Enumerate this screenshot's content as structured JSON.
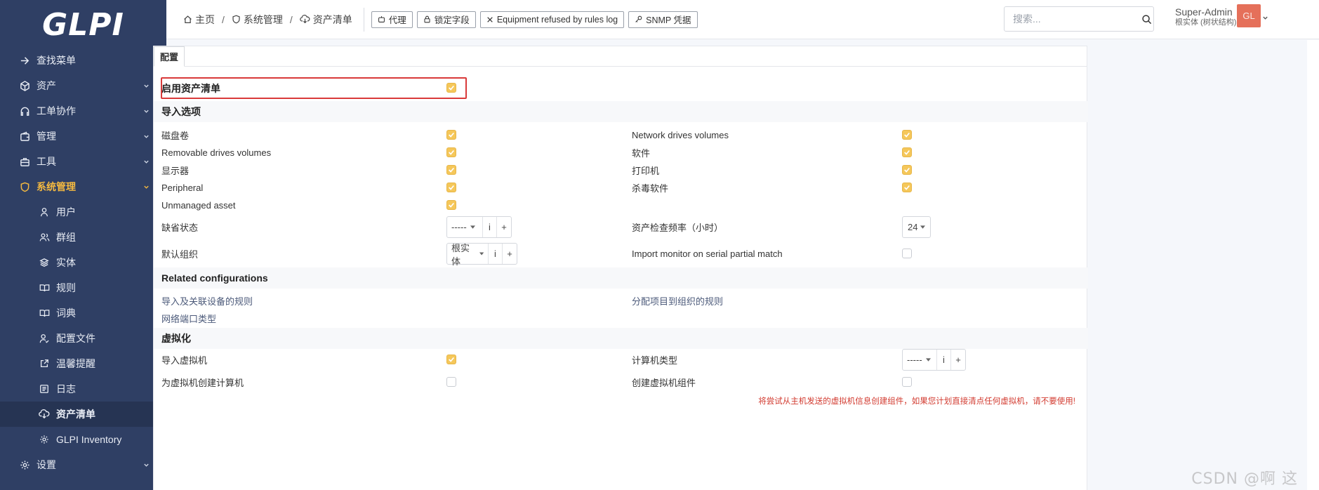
{
  "app": {
    "logo_text": "GLPI"
  },
  "sidebar": {
    "top": {
      "label": "查找菜单",
      "icon": "arrow-right-icon"
    },
    "items": [
      {
        "label": "资产",
        "icon": "cube-icon",
        "expandable": true
      },
      {
        "label": "工单协作",
        "icon": "headset-icon",
        "expandable": true
      },
      {
        "label": "管理",
        "icon": "wallet-icon",
        "expandable": true
      },
      {
        "label": "工具",
        "icon": "briefcase-icon",
        "expandable": true
      },
      {
        "label": "系统管理",
        "icon": "shield-icon",
        "expandable": true,
        "active": true
      }
    ],
    "sub_items": [
      {
        "label": "用户",
        "icon": "user-icon"
      },
      {
        "label": "群组",
        "icon": "users-icon"
      },
      {
        "label": "实体",
        "icon": "layers-icon"
      },
      {
        "label": "规则",
        "icon": "book-icon"
      },
      {
        "label": "词典",
        "icon": "book-icon"
      },
      {
        "label": "配置文件",
        "icon": "user-check-icon"
      },
      {
        "label": "温馨提醒",
        "icon": "external-icon"
      },
      {
        "label": "日志",
        "icon": "list-icon"
      },
      {
        "label": "资产清单",
        "icon": "cloud-download-icon",
        "current": true
      },
      {
        "label": "GLPI Inventory",
        "icon": "gear-icon"
      }
    ],
    "bottom": {
      "label": "设置",
      "icon": "gear-icon",
      "expandable": true
    }
  },
  "header": {
    "breadcrumb": [
      "主页",
      "系统管理",
      "资产清单"
    ],
    "buttons": [
      "代理",
      "锁定字段",
      "Equipment refused by rules log",
      "SNMP 凭据"
    ],
    "search_placeholder": "搜索...",
    "user_name": "Super-Admin",
    "user_entity": "根实体 (树状结构)",
    "avatar_initials": "GL"
  },
  "tabs": [
    "配置"
  ],
  "form": {
    "enable_label": "启用资产清单",
    "enable_checked": true,
    "import_section": "导入选项",
    "options_left": [
      {
        "label": "磁盘卷",
        "checked": true
      },
      {
        "label": "Removable drives volumes",
        "checked": true
      },
      {
        "label": "显示器",
        "checked": true
      },
      {
        "label": "Peripheral",
        "checked": true
      },
      {
        "label": "Unmanaged asset",
        "checked": true
      }
    ],
    "options_right": [
      {
        "label": "Network drives volumes",
        "checked": true
      },
      {
        "label": "软件",
        "checked": true
      },
      {
        "label": "打印机",
        "checked": true
      },
      {
        "label": "杀毒软件",
        "checked": true
      }
    ],
    "default_status_label": "缺省状态",
    "default_status_value": "-----",
    "check_frequency_label": "资产检查频率（小时）",
    "check_frequency_value": "24",
    "default_entity_label": "默认组织",
    "default_entity_value": "根实体",
    "monitor_serial_label": "Import monitor on serial partial match",
    "monitor_serial_checked": false,
    "info_btn": "i",
    "add_btn": "+",
    "related_section": "Related configurations",
    "related_links": [
      "导入及关联设备的规则",
      "分配项目到组织的规则",
      "网络端口类型"
    ],
    "virt_section": "虚拟化",
    "import_vm_label": "导入虚拟机",
    "import_vm_checked": true,
    "computer_type_label": "计算机类型",
    "computer_type_value": "-----",
    "create_computer_vm_label": "为虚拟机创建计算机",
    "create_computer_vm_checked": false,
    "create_vm_components_label": "创建虚拟机组件",
    "create_vm_components_checked": false,
    "warning_text": "将尝试从主机发送的虚拟机信息创建组件，如果您计划直接清点任何虚拟机，请不要使用!"
  },
  "watermark": "CSDN @啊 这",
  "colors": {
    "sidebar": "#2f3f64",
    "accent": "#f4b940",
    "checkbox": "#f5c75a",
    "warning": "#d23a2f",
    "highlight": "#d93a3a"
  }
}
